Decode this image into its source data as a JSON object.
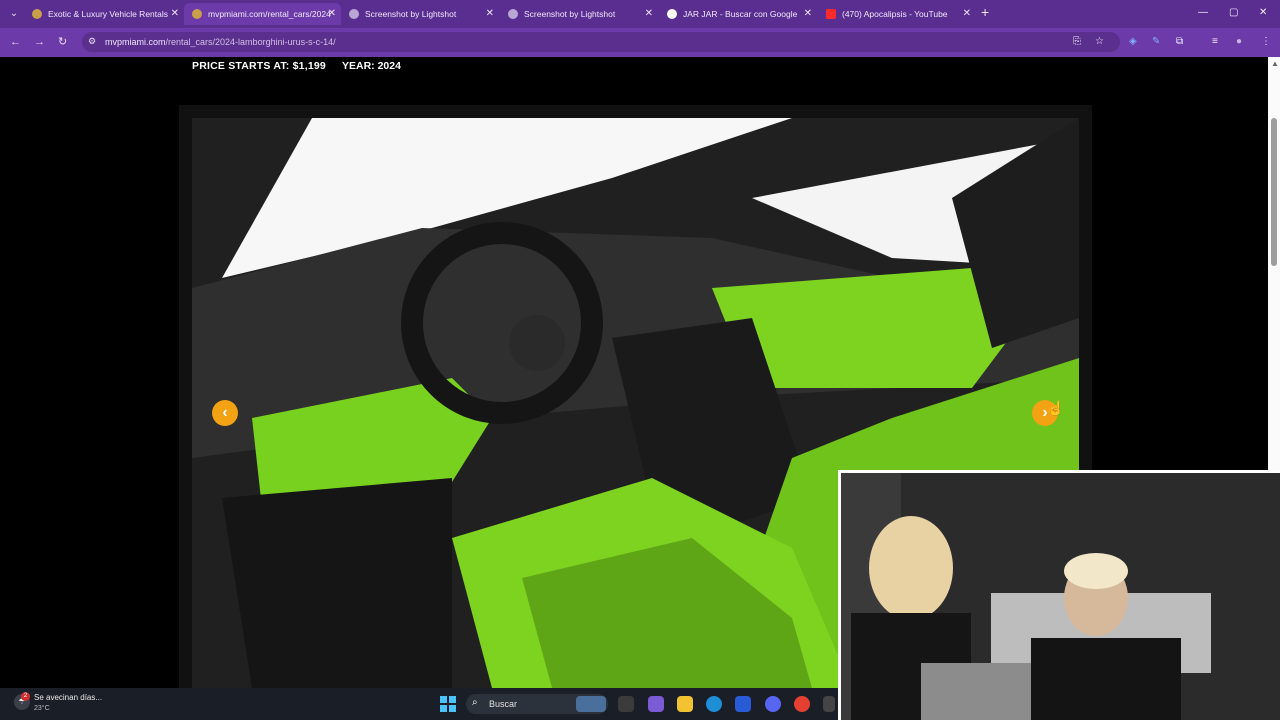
{
  "browser": {
    "tabs": [
      {
        "title": "Exotic & Luxury Vehicle Rentals",
        "favicon_color": "#c8a04a"
      },
      {
        "title": "mvpmiami.com/rental_cars/2024",
        "favicon_color": "#c8a04a"
      },
      {
        "title": "Screenshot by Lightshot",
        "favicon_color": "#b9a6d4"
      },
      {
        "title": "Screenshot by Lightshot",
        "favicon_color": "#b9a6d4"
      },
      {
        "title": "JAR JAR - Buscar con Google",
        "favicon_color": "#ffffff"
      },
      {
        "title": "(470) Apocalipsis - YouTube",
        "favicon_color": "#ff2a2a"
      }
    ],
    "tab_close_glyph": "✕",
    "new_tab_glyph": "+",
    "window_controls": [
      "—",
      "▢",
      "✕"
    ],
    "nav_glyphs": {
      "back": "←",
      "forward": "→",
      "reload": "↻",
      "site_info": "⚙"
    },
    "url_domain": "mvpmiami.com",
    "url_path": "/rental_cars/2024-lamborghini-urus-s-c-14/",
    "toolbar_glyphs": [
      "⎘",
      "☆",
      "◈",
      "✎",
      "⧉",
      "≡",
      "●",
      "⋮"
    ]
  },
  "listing": {
    "price": "PRICE STARTS AT: $1,199",
    "year": "YEAR: 2024"
  },
  "gallery": {
    "prev_glyph": "‹",
    "next_glyph": "›",
    "accent": "#f3a214"
  },
  "taskbar": {
    "weather_text": "Se avecinan días...",
    "weather_temp": "23°C",
    "weather_badge": "2",
    "search_placeholder": "Buscar",
    "search_glyph": "⌕"
  },
  "colors": {
    "browser_frame": "#5a2d91",
    "toolbar": "#6d3ba9",
    "interior_green": "#7ed321"
  }
}
